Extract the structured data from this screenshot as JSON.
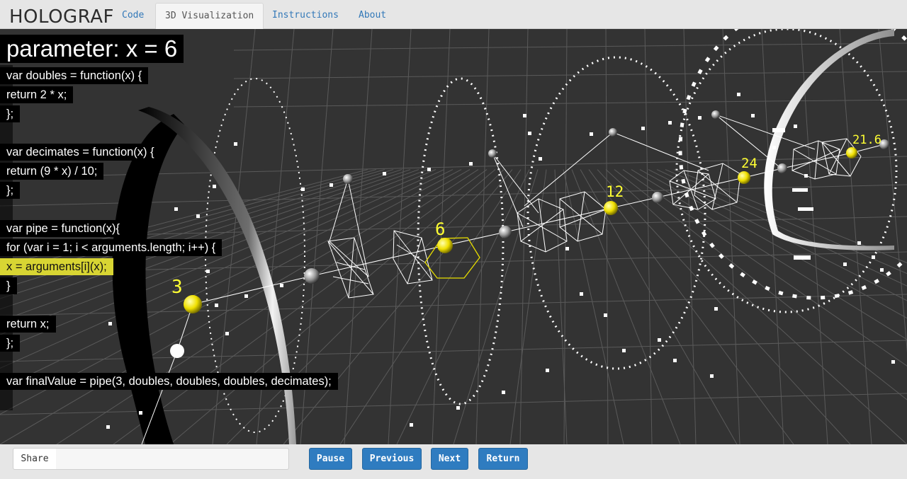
{
  "app": {
    "brand": "HOLOGRAF"
  },
  "nav": {
    "tabs": [
      {
        "label": "Code",
        "active": false
      },
      {
        "label": "3D Visualization",
        "active": true
      },
      {
        "label": "Instructions",
        "active": false
      },
      {
        "label": "About",
        "active": false
      }
    ]
  },
  "overlay": {
    "parameter_text": "parameter: x = 6",
    "code_lines": [
      "var doubles = function(x) {",
      "return 2 * x;",
      "};",
      "",
      "var decimates = function(x) {",
      "return (9 * x) / 10;",
      "};",
      "",
      "var pipe = function(x){",
      "for (var i = 1; i < arguments.length; i++) {",
      "x = arguments[i](x);",
      "}",
      "",
      "return x;",
      "};",
      "",
      "var finalValue = pipe(3, doubles, doubles, doubles, decimates);"
    ],
    "highlighted_line_index": 10
  },
  "visualization": {
    "value_labels": [
      "3",
      "6",
      "12",
      "24",
      "21.6"
    ],
    "colors": {
      "background": "#333333",
      "grid": "#5a5a5a",
      "highlight": "#ffff00",
      "node": "#cccccc",
      "wire": "#ffffff"
    }
  },
  "bottom": {
    "share_label": "Share",
    "share_value": "",
    "buttons": {
      "pause": "Pause",
      "previous": "Previous",
      "next": "Next",
      "return": "Return"
    }
  }
}
